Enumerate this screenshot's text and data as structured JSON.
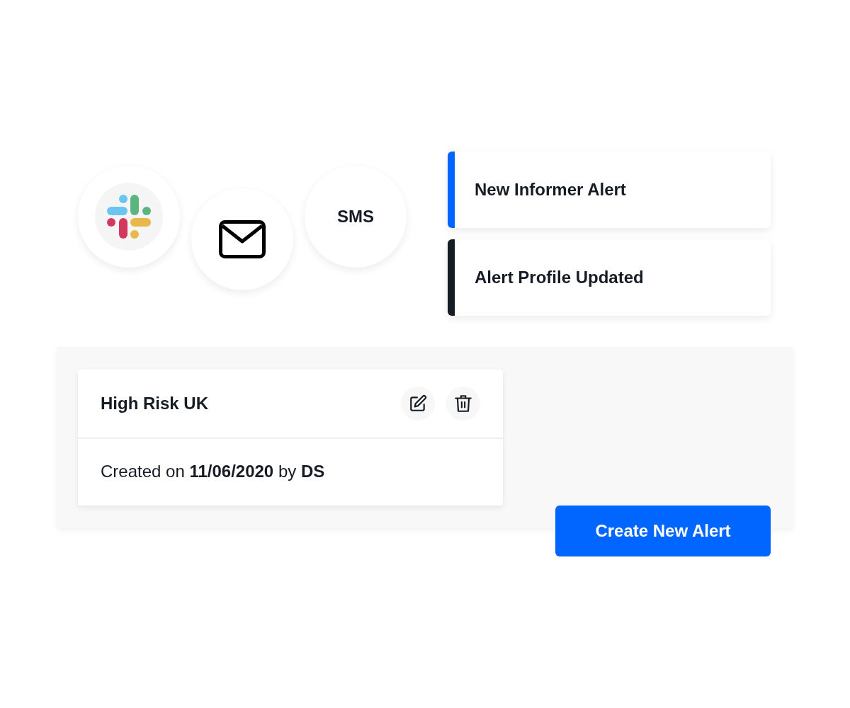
{
  "channels": [
    {
      "kind": "logo"
    },
    {
      "kind": "mail"
    },
    {
      "kind": "text",
      "label": "SMS"
    }
  ],
  "notifications": [
    {
      "title": "New Informer Alert",
      "color": "#0066ff"
    },
    {
      "title": "Alert Profile Updated",
      "color": "#161c24"
    }
  ],
  "alert_card": {
    "title": "High Risk UK",
    "actions": [
      {
        "kind": "edit"
      },
      {
        "kind": "delete"
      }
    ],
    "meta": "Created on **11/06/2020** by **DS**"
  },
  "create_button": "Create New Alert"
}
